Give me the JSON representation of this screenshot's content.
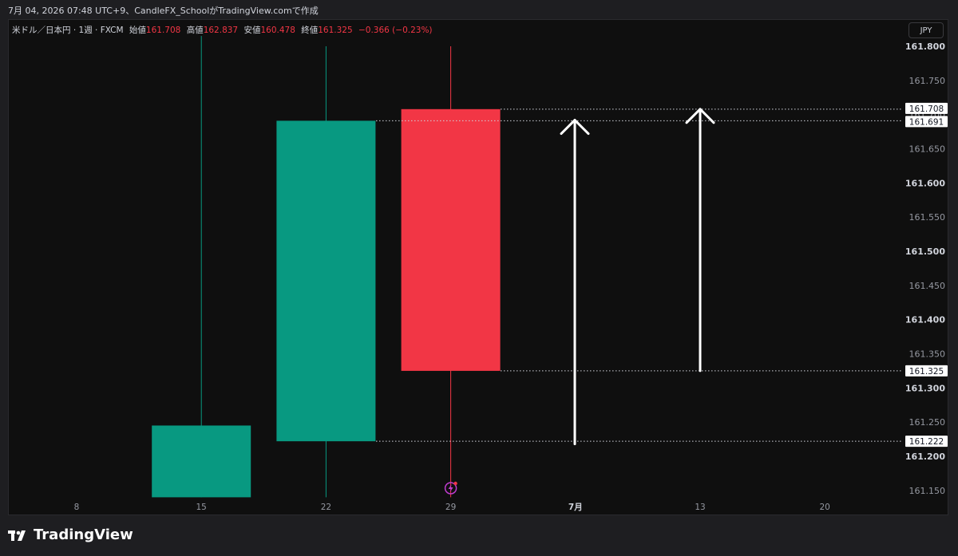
{
  "header": {
    "caption": "7月 04, 2026 07:48 UTC+9、CandleFX_SchoolがTradingView.comで作成"
  },
  "legend": {
    "symbol": "米ドル／日本円 · 1週 · FXCM",
    "open_label": "始値",
    "open": "161.708",
    "high_label": "高値",
    "high": "162.837",
    "low_label": "安値",
    "low": "160.478",
    "close_label": "終値",
    "close": "161.325",
    "change": "−0.366 (−0.23%)"
  },
  "currency_button": "JPY",
  "brand": {
    "logo_text": "TradingView",
    "icon": "tradingview-logo-icon"
  },
  "colors": {
    "up": "#089981",
    "down": "#f23645",
    "background": "#0f0f0f",
    "arrow": "#ffffff"
  },
  "chart_data": {
    "type": "candlestick",
    "symbol": "USDJPY",
    "timeframe": "1W",
    "y_axis_ticks": [
      "161.800",
      "161.750",
      "161.700",
      "161.650",
      "161.600",
      "161.550",
      "161.500",
      "161.450",
      "161.400",
      "161.350",
      "161.300",
      "161.250",
      "161.200",
      "161.150"
    ],
    "y_axis_ticks_bold": [
      "161.800",
      "161.600",
      "161.500",
      "161.400",
      "161.300",
      "161.200"
    ],
    "x_axis_ticks": [
      "8",
      "15",
      "22",
      "29",
      "7月",
      "13",
      "20"
    ],
    "x_axis_ticks_bold": [
      "7月"
    ],
    "candles": [
      {
        "x": "15",
        "open": 161.14,
        "high": 161.815,
        "low": 161.14,
        "close": 161.245,
        "direction": "up"
      },
      {
        "x": "22",
        "open": 161.222,
        "high": 161.8,
        "low": 161.14,
        "close": 161.691,
        "direction": "up"
      },
      {
        "x": "29",
        "open": 161.708,
        "high": 161.8,
        "low": 161.14,
        "close": 161.325,
        "direction": "down"
      }
    ],
    "price_levels": [
      "161.708",
      "161.691",
      "161.325",
      "161.222"
    ],
    "annotations": [
      {
        "type": "arrow-up",
        "x": "7月",
        "from": 161.218,
        "to": 161.692
      },
      {
        "type": "arrow-up",
        "x": "13",
        "from": 161.325,
        "to": 161.708
      }
    ],
    "event_marker": {
      "x": "29",
      "icon": "lightning-icon"
    }
  }
}
